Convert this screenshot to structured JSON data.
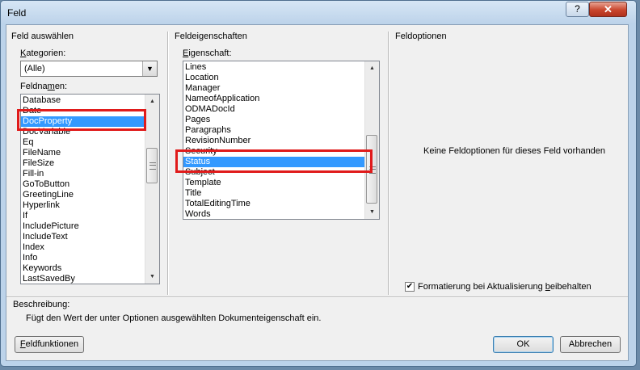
{
  "window": {
    "title": "Feld",
    "help_label": "?",
    "close_label": "✕"
  },
  "left_group": {
    "title": "Feld auswählen",
    "category_label_parts": [
      "K",
      "ategorien:"
    ],
    "category_value": "(Alle)",
    "fieldnames_label_parts": [
      "Feldna",
      "m",
      "en:"
    ],
    "fieldnames": [
      "Database",
      "Date",
      "DocProperty",
      "DocVariable",
      "Eq",
      "FileName",
      "FileSize",
      "Fill-in",
      "GoToButton",
      "GreetingLine",
      "Hyperlink",
      "If",
      "IncludePicture",
      "IncludeText",
      "Index",
      "Info",
      "Keywords",
      "LastSavedBy"
    ],
    "selected_fieldname": "DocProperty"
  },
  "middle_group": {
    "title": "Feldeigenschaften",
    "property_label_parts": [
      "E",
      "igenschaft:"
    ],
    "properties": [
      "Lines",
      "Location",
      "Manager",
      "NameofApplication",
      "ODMADocId",
      "Pages",
      "Paragraphs",
      "RevisionNumber",
      "Security",
      "Status",
      "Subject",
      "Template",
      "Title",
      "TotalEditingTime",
      "Words"
    ],
    "selected_property": "Status"
  },
  "right_group": {
    "title": "Feldoptionen",
    "empty_message": "Keine Feldoptionen für dieses Feld vorhanden",
    "preserve_label_parts": [
      "Formatierung bei Aktualisierung ",
      "b",
      "eibehalten"
    ],
    "preserve_checked": true
  },
  "description": {
    "label": "Beschreibung:",
    "text": "Fügt den Wert der unter Optionen ausgewählten Dokumenteigenschaft ein."
  },
  "buttons": {
    "field_codes_parts": [
      "F",
      "eldfunktionen"
    ],
    "ok": "OK",
    "cancel": "Abbrechen"
  },
  "colors": {
    "selection": "#3399ff",
    "highlight_box": "#e01b1b"
  }
}
